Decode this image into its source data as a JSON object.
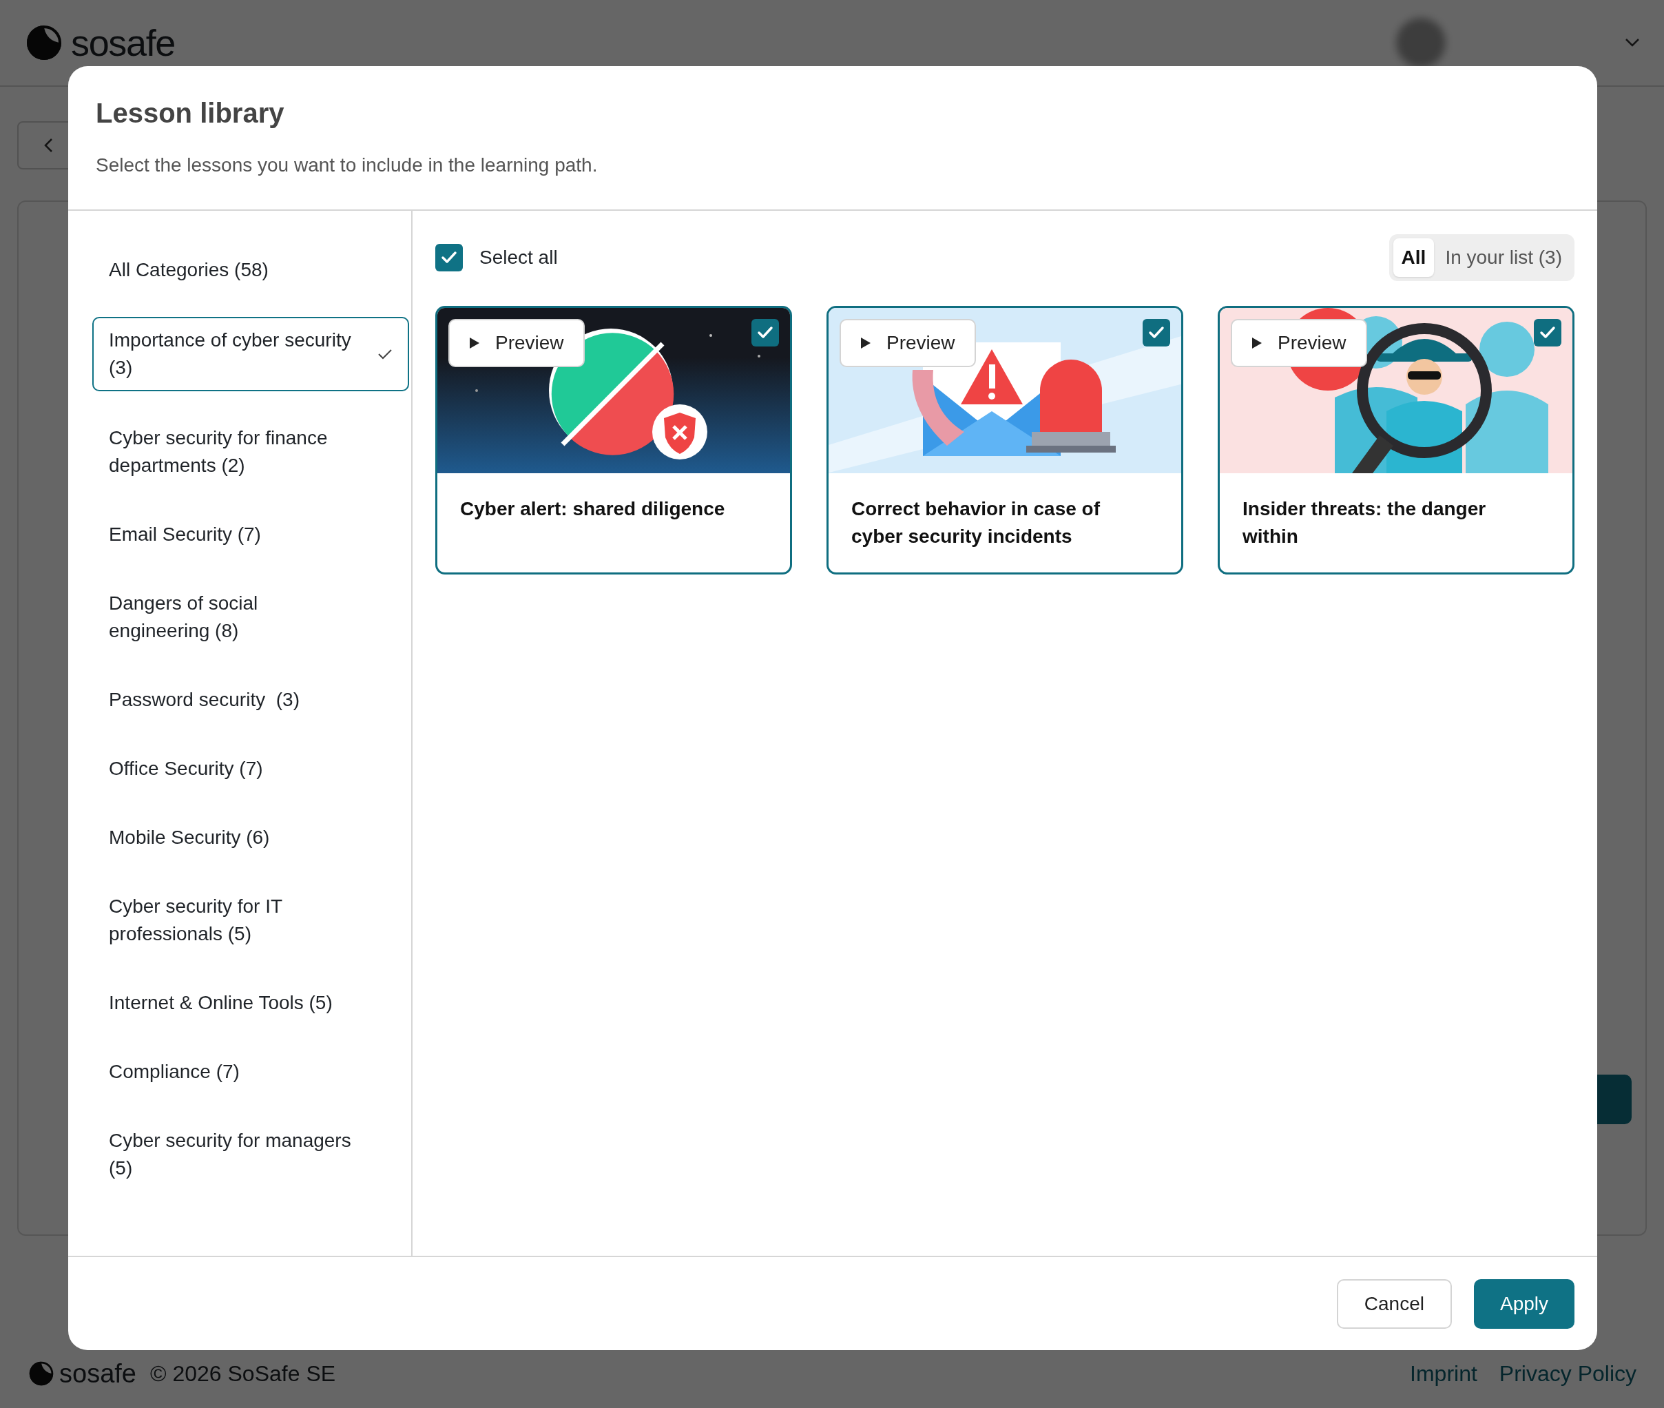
{
  "app": {
    "logo": "sosafe"
  },
  "dialog": {
    "title": "Lesson library",
    "subtitle": "Select the lessons you want to include in the learning path.",
    "categories": [
      {
        "label": "All Categories (58)",
        "selected": false
      },
      {
        "label": "Importance of cyber security (3)",
        "selected": true
      },
      {
        "label": "Cyber security for finance departments (2)",
        "selected": false
      },
      {
        "label": "Email Security (7)",
        "selected": false
      },
      {
        "label": "Dangers of social engineering (8)",
        "selected": false
      },
      {
        "label": "Password security  (3)",
        "selected": false
      },
      {
        "label": "Office Security (7)",
        "selected": false
      },
      {
        "label": "Mobile Security (6)",
        "selected": false
      },
      {
        "label": "Cyber security for IT professionals (5)",
        "selected": false
      },
      {
        "label": "Internet & Online Tools (5)",
        "selected": false
      },
      {
        "label": "Compliance (7)",
        "selected": false
      },
      {
        "label": "Cyber security for managers (5)",
        "selected": false
      }
    ],
    "select_all": {
      "label": "Select all",
      "checked": true
    },
    "filter_tabs": [
      {
        "label": "All",
        "selected": true
      },
      {
        "label": "In your list (3)",
        "selected": false
      }
    ],
    "lessons": [
      {
        "title": "Cyber alert: shared diligence",
        "preview": "Preview",
        "checked": true
      },
      {
        "title": "Correct behavior in case of cyber security incidents",
        "preview": "Preview",
        "checked": true
      },
      {
        "title": "Insider threats: the danger within",
        "preview": "Preview",
        "checked": true
      }
    ],
    "buttons": [
      {
        "label": "Cancel",
        "kind": "secondary"
      },
      {
        "label": "Apply",
        "kind": "primary"
      }
    ]
  },
  "footer": {
    "logo": "sosafe",
    "copyright": "© 2026 SoSafe SE",
    "links": [
      "Imprint",
      "Privacy Policy"
    ]
  }
}
